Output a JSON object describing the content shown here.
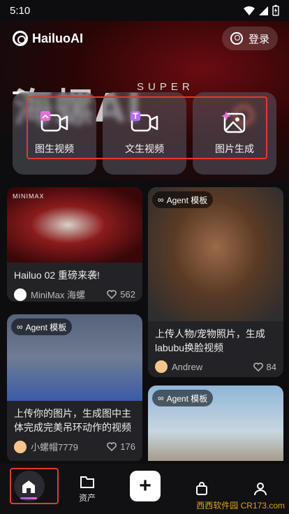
{
  "status": {
    "time": "5:10"
  },
  "brand": {
    "name": "HailuoAI"
  },
  "header": {
    "login_label": "登录"
  },
  "hero": {
    "headline": "海螺AI",
    "super_text": "SUPER"
  },
  "quick_actions": [
    {
      "label": "图生视频",
      "icon": "image-to-video-icon"
    },
    {
      "label": "文生视频",
      "icon": "text-to-video-icon"
    },
    {
      "label": "图片生成",
      "icon": "image-generate-icon"
    }
  ],
  "feed": {
    "cards": [
      {
        "badge": "MINIMAX",
        "title": "Hailuo 02 重磅来袭!",
        "author": "MiniMax 海螺",
        "likes": "562"
      },
      {
        "badge": "Agent 模板",
        "title": "上传人物/宠物照片，生成labubu换脸视频",
        "author": "Andrew",
        "likes": "84"
      },
      {
        "badge": "Agent 模板",
        "title": "上传你的图片，生成图中主体完成完美吊环动作的视频",
        "author": "小螺帽7779",
        "likes": "176"
      },
      {
        "badge": "Agent 模板",
        "title": "",
        "author": "",
        "likes": ""
      }
    ]
  },
  "tabbar": {
    "home_label": "首页",
    "assets_label": "资产",
    "watermark": "西西软件园 CR173.com"
  },
  "colors": {
    "accent_red": "#e23a2c",
    "background": "#0d0d0f",
    "card": "#232327"
  }
}
